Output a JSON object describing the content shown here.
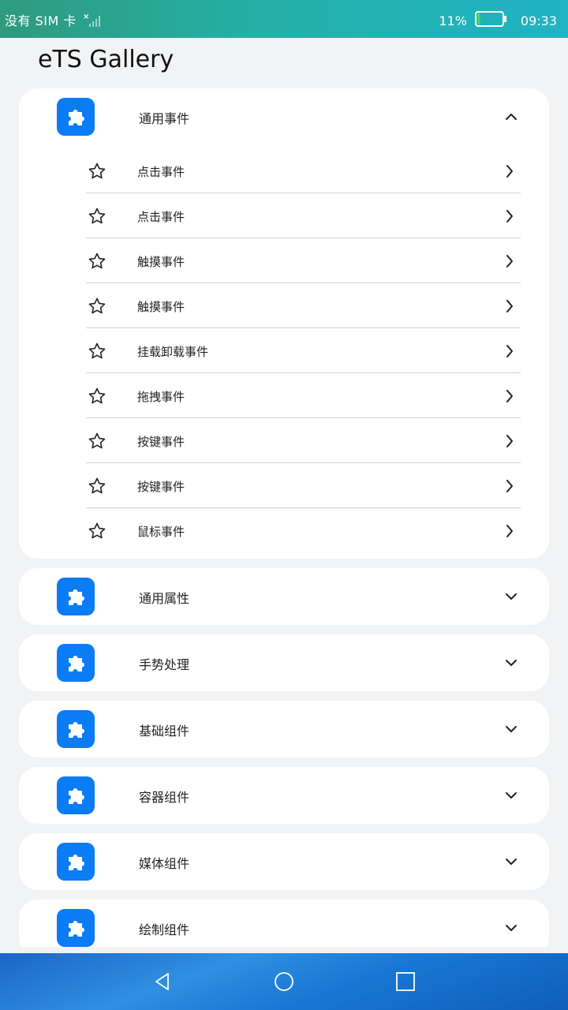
{
  "status_bar": {
    "carrier": "没有 SIM 卡",
    "battery_percent": "11%",
    "battery_level": 0.11,
    "time": "09:33"
  },
  "app": {
    "title": "eTS Gallery"
  },
  "groups": [
    {
      "title": "通用事件",
      "expanded": true,
      "icon": "puzzle-icon",
      "items": [
        {
          "label": "点击事件",
          "icon": "star-outline-icon"
        },
        {
          "label": "点击事件",
          "icon": "star-outline-icon"
        },
        {
          "label": "触摸事件",
          "icon": "star-outline-icon"
        },
        {
          "label": "触摸事件",
          "icon": "star-outline-icon"
        },
        {
          "label": "挂载卸载事件",
          "icon": "star-outline-icon"
        },
        {
          "label": "拖拽事件",
          "icon": "star-outline-icon"
        },
        {
          "label": "按键事件",
          "icon": "star-outline-icon"
        },
        {
          "label": "按键事件",
          "icon": "star-outline-icon"
        },
        {
          "label": "鼠标事件",
          "icon": "star-outline-icon"
        }
      ]
    },
    {
      "title": "通用属性",
      "expanded": false,
      "icon": "puzzle-icon"
    },
    {
      "title": "手势处理",
      "expanded": false,
      "icon": "puzzle-icon"
    },
    {
      "title": "基础组件",
      "expanded": false,
      "icon": "puzzle-icon"
    },
    {
      "title": "容器组件",
      "expanded": false,
      "icon": "puzzle-icon"
    },
    {
      "title": "媒体组件",
      "expanded": false,
      "icon": "puzzle-icon"
    },
    {
      "title": "绘制组件",
      "expanded": false,
      "icon": "puzzle-icon"
    }
  ],
  "colors": {
    "accent": "#0a7cf5",
    "background": "#f1f3f5",
    "card": "#ffffff"
  },
  "nav_bar": {
    "buttons": [
      "back-icon",
      "home-icon",
      "recents-icon"
    ]
  }
}
